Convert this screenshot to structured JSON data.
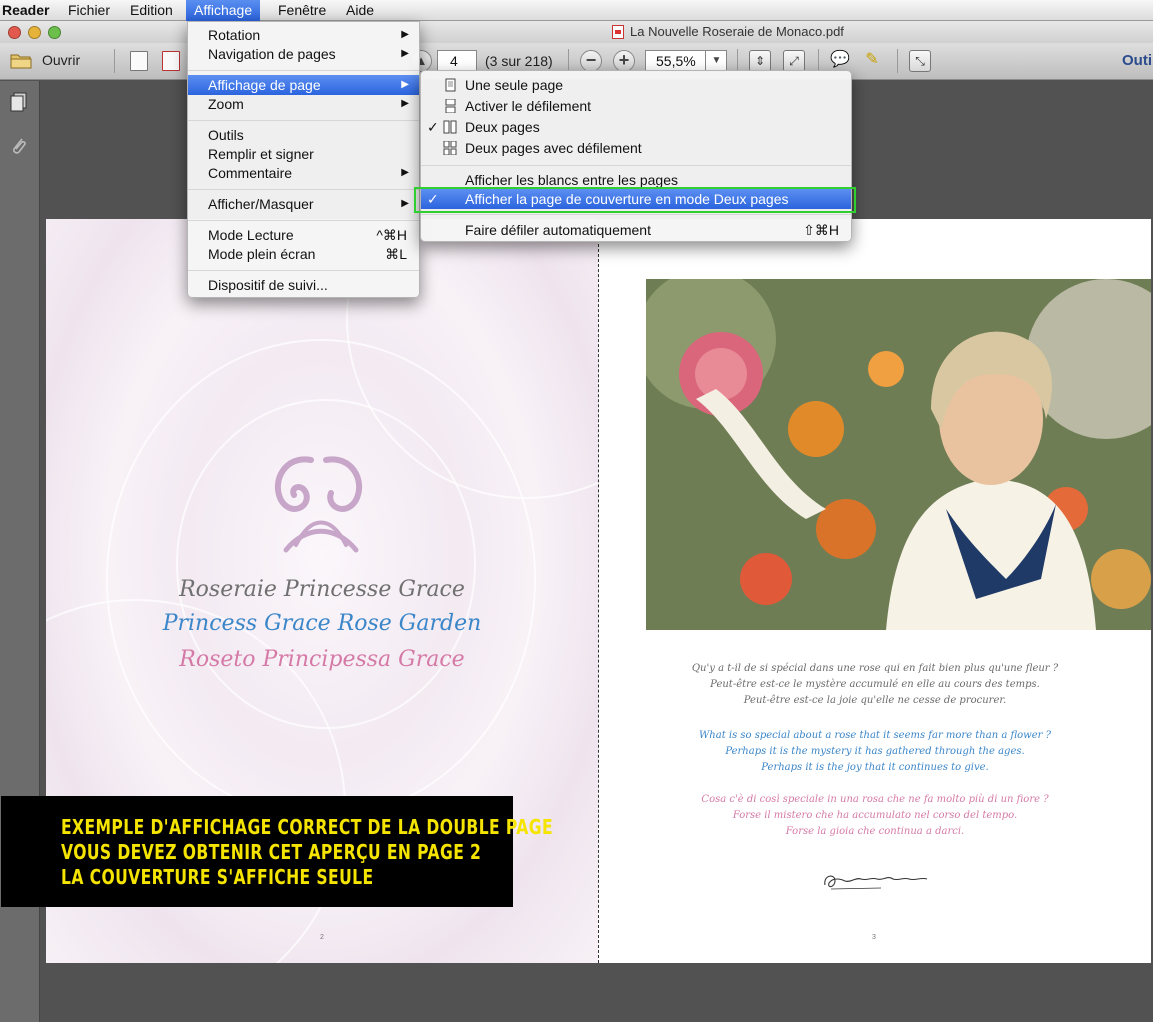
{
  "menubar": {
    "app": "Reader",
    "items": [
      "Fichier",
      "Edition",
      "Affichage",
      "Fenêtre",
      "Aide"
    ]
  },
  "window": {
    "title": "La Nouvelle Roseraie de Monaco.pdf"
  },
  "toolbar": {
    "open_label": "Ouvrir",
    "page_value": "4",
    "page_count": "(3 sur 218)",
    "zoom_value": "55,5%",
    "tools_label": "Outi"
  },
  "affichage_menu": {
    "items": [
      {
        "label": "Rotation",
        "submenu": true
      },
      {
        "label": "Navigation de pages",
        "submenu": true
      },
      {
        "label": "Affichage de page",
        "submenu": true
      },
      {
        "label": "Zoom",
        "submenu": true
      },
      {
        "label": "Outils"
      },
      {
        "label": "Remplir et signer"
      },
      {
        "label": "Commentaire",
        "submenu": true
      },
      {
        "label": "Afficher/Masquer",
        "submenu": true
      },
      {
        "label": "Mode Lecture",
        "shortcut": "^⌘H"
      },
      {
        "label": "Mode plein écran",
        "shortcut": "⌘L"
      },
      {
        "label": "Dispositif de suivi..."
      }
    ]
  },
  "page_display_submenu": {
    "items": [
      {
        "label": "Une seule page",
        "checked": false
      },
      {
        "label": "Activer le défilement",
        "checked": false
      },
      {
        "label": "Deux pages",
        "checked": true
      },
      {
        "label": "Deux pages avec défilement",
        "checked": false
      },
      {
        "label": "Afficher les blancs entre les pages",
        "checked": false
      },
      {
        "label": "Afficher la page de couverture en mode Deux pages",
        "checked": true
      },
      {
        "label": "Faire défiler automatiquement",
        "shortcut": "⇧⌘H"
      }
    ],
    "check_mark": "✓"
  },
  "document": {
    "left_titles": [
      "Roseraie Princesse Grace",
      "Princess Grace Rose Garden",
      "Roseto Principessa Grace"
    ],
    "quote_fr": [
      "Qu'y a t-il de si spécial dans une rose qui en fait bien plus qu'une fleur ?",
      "Peut-être est-ce le mystère accumulé en elle au cours des temps.",
      "Peut-être est-ce la joie qu'elle ne cesse de procurer."
    ],
    "quote_en": [
      "What is so special about a rose that it seems far more than a flower ?",
      "Perhaps it is the mystery it has gathered through the ages.",
      "Perhaps it is the joy that it continues to give."
    ],
    "quote_it": [
      "Cosa c'è di così speciale in una rosa che ne fa molto più di un fiore ?",
      "Forse il mistero che ha accumulato nel corso del tempo.",
      "Forse la gioia che continua a darci."
    ],
    "page_left_number": "2",
    "page_right_number": "3"
  },
  "banner": {
    "lines": [
      "EXEMPLE D'AFFICHAGE CORRECT DE LA DOUBLE PAGE",
      "VOUS DEVEZ OBTENIR CET APERÇU EN PAGE 2",
      "LA COUVERTURE  S'AFFICHE SEULE"
    ]
  },
  "colors": {
    "menu_highlight": "#2b64de",
    "title_grey": "#707070",
    "title_blue": "#3a86c8",
    "title_pink": "#d57aa7",
    "banner_text": "#f5e400",
    "annotation_green": "#2fcf2f"
  }
}
